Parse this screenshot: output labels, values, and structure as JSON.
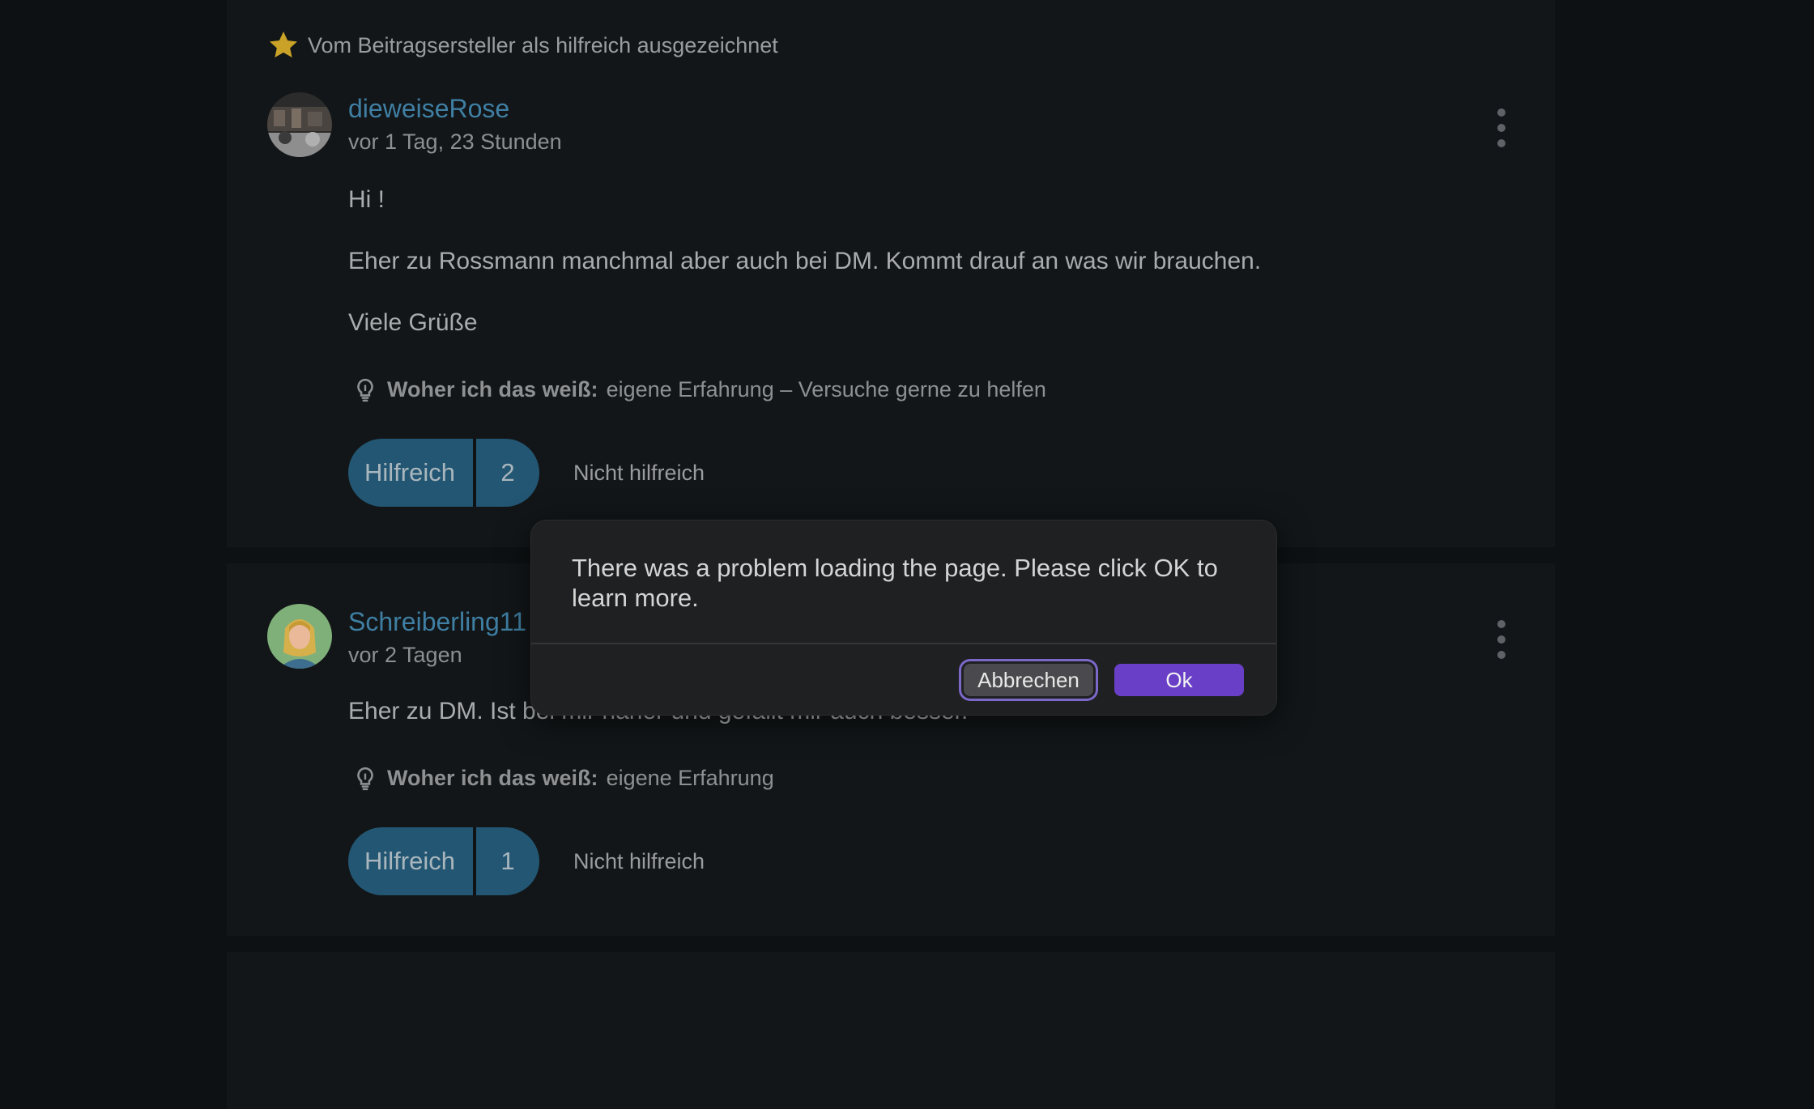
{
  "post1": {
    "helpful_flag": "Vom Beitragsersteller als hilfreich ausgezeichnet",
    "author": "dieweiseRose",
    "time": "vor 1 Tag, 23 Stunden",
    "body": [
      "Hi !",
      "Eher zu Rossmann manchmal aber auch bei DM. Kommt drauf an was wir brauchen.",
      "Viele Grüße"
    ],
    "source_label": "Woher ich das weiß:",
    "source_value": "eigene Erfahrung – Versuche gerne zu helfen",
    "helpful_label": "Hilfreich",
    "helpful_count": "2",
    "not_helpful_label": "Nicht hilfreich"
  },
  "post2": {
    "author": "Schreiberling11",
    "time": "vor 2 Tagen",
    "body": "Eher zu DM. Ist bei mir näher und gefällt mir auch besser.",
    "source_label": "Woher ich das weiß:",
    "source_value": "eigene Erfahrung",
    "helpful_label": "Hilfreich",
    "helpful_count": "1",
    "not_helpful_label": "Nicht hilfreich"
  },
  "dialog": {
    "message": "There was a problem loading the page. Please click OK to learn more.",
    "cancel_label": "Abbrechen",
    "ok_label": "Ok"
  },
  "colors": {
    "background": "#0d1113",
    "card": "#121618",
    "author_link": "#3f7fa3",
    "helpful_button": "#235673",
    "ok_button": "#6a3fc7",
    "star": "#c9a227"
  }
}
